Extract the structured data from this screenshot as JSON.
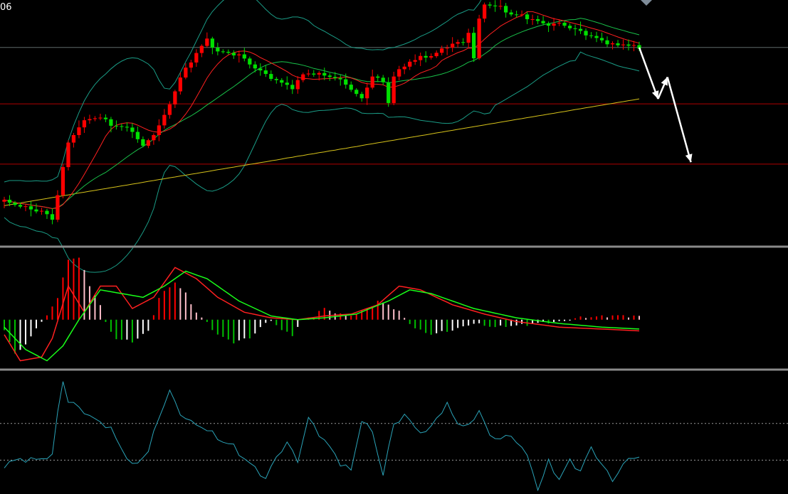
{
  "corner_label": "06",
  "colors": {
    "background": "#000000",
    "bull_candle": "#ff0000",
    "bear_candle": "#00e000",
    "bollinger_bands": "#1a9c86",
    "ma_short": "#ff2020",
    "ma_mid": "#19c24a",
    "ma_long": "#d6c21a",
    "horizontal_level": "#b00000",
    "current_price_line": "#5f6a6a",
    "panel_divider": "#8a8a8a",
    "macd_hist_positive": "#ff0000",
    "macd_hist_positive_fading": "#ffc0cb",
    "macd_hist_negative": "#00c000",
    "macd_hist_negative_fading": "#ffffff",
    "macd_line": "#ff2020",
    "signal_line": "#19ff19",
    "oscillator": "#2aa3b8",
    "oscillator_levels": "#9a9a9a",
    "projection_arrow": "#ffffff",
    "scroll_marker": "#7f8c99"
  },
  "chart_data": [
    {
      "type": "candlestick",
      "panel": "price",
      "series": [
        {
          "name": "",
          "kind": "ohlc",
          "values": []
        },
        {
          "name": "",
          "kind": "moving-average-short",
          "values": []
        },
        {
          "name": "",
          "kind": "moving-average-mid",
          "values": []
        },
        {
          "name": "",
          "kind": "moving-average-long",
          "values": []
        },
        {
          "name": "",
          "kind": "bollinger-upper",
          "values": []
        },
        {
          "name": "",
          "kind": "bollinger-lower",
          "values": []
        }
      ],
      "levels": [
        {
          "kind": "resistance-support",
          "value": 0.715
        },
        {
          "kind": "support",
          "value": 0.41
        }
      ],
      "current_price": 1.0,
      "projection": [
        {
          "step": 0,
          "value": 1.0
        },
        {
          "step": 4,
          "value": 0.74
        },
        {
          "step": 6,
          "value": 0.85
        },
        {
          "step": 11,
          "value": 0.42
        }
      ],
      "ylim": [
        0,
        1.24
      ],
      "grid": false,
      "legend": "none",
      "bars": 120
    },
    {
      "type": "bar",
      "panel": "macd",
      "series": [
        {
          "name": "",
          "kind": "histogram",
          "values": []
        },
        {
          "name": "",
          "kind": "macd-line",
          "values": []
        },
        {
          "name": "",
          "kind": "signal-line",
          "values": []
        }
      ],
      "ylim": [
        -1.3,
        1.9
      ],
      "grid": false,
      "legend": "none"
    },
    {
      "type": "line",
      "panel": "oscillator",
      "series": [
        {
          "name": "",
          "kind": "oscillator",
          "values": []
        }
      ],
      "levels": [
        0.55,
        0.16
      ],
      "ylim": [
        -0.2,
        1.1
      ],
      "grid": false,
      "legend": "none"
    }
  ]
}
